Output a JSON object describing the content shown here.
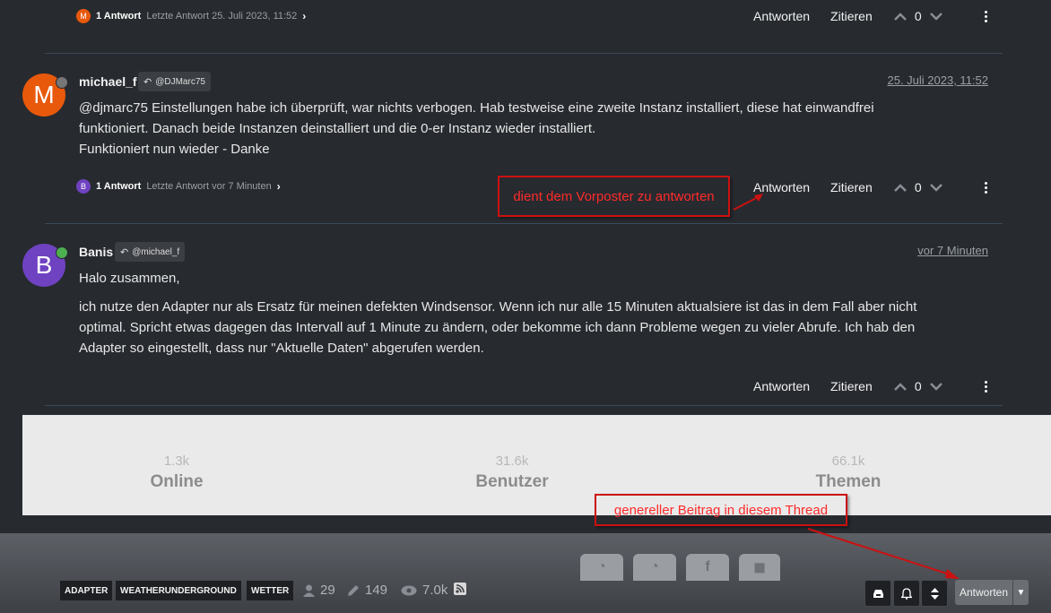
{
  "post_top": {
    "reply_avatar_letter": "M",
    "reply_count": "1 Antwort",
    "last_reply": "Letzte Antwort 25. Juli 2023, 11:52"
  },
  "post_michael": {
    "avatar_letter": "M",
    "author": "michael_f",
    "reply_to": "@DJMarc75",
    "timestamp": "25. Juli 2023, 11:52",
    "line1": "@djmarc75 Einstellungen habe ich überprüft, war nichts verbogen. Hab testweise eine zweite Instanz installiert, diese hat einwandfrei",
    "line2": "funktioniert. Danach beide Instanzen deinstalliert und die 0-er Instanz wieder installiert.",
    "line3": "Funktioniert nun wieder - Danke",
    "reply_avatar_letter": "B",
    "reply_count": "1 Antwort",
    "last_reply": "Letzte Antwort vor 7 Minuten"
  },
  "post_banis": {
    "avatar_letter": "B",
    "author": "Banis",
    "reply_to": "@michael_f",
    "timestamp": "vor 7 Minuten",
    "greeting": "Halo zusammen,",
    "para_line1": "ich nutze den Adapter nur als Ersatz für meinen defekten Windsensor. Wenn ich nur alle 15 Minuten aktualsiere ist das in dem Fall aber nicht",
    "para_line2": "optimal. Spricht etwas dagegen das Intervall auf 1 Minute zu ändern, oder bekomme ich dann Probleme wegen zu vieler Abrufe. Ich hab den",
    "para_line3": "Adapter so eingestellt, dass nur \"Aktuelle Daten\" abgerufen werden."
  },
  "actions": {
    "reply": "Antworten",
    "quote": "Zitieren",
    "votes": "0"
  },
  "annotations": {
    "reply_to_previous": "dient dem Vorposter zu antworten",
    "general_post": "genereller Beitrag in diesem Thread"
  },
  "stats": [
    {
      "value": "1.3k",
      "label": "Online"
    },
    {
      "value": "31.6k",
      "label": "Benutzer"
    },
    {
      "value": "66.1k",
      "label": "Themen"
    }
  ],
  "tags": [
    "ADAPTER",
    "WEATHERUNDERGROUND",
    "WETTER"
  ],
  "thread_stats": {
    "posters": "29",
    "posts": "149",
    "views": "7.0k"
  },
  "bottom_reply": "Antworten",
  "colors": {
    "avatar_m": "#e8590c",
    "avatar_b": "#6f42c1",
    "online": "#4caf50",
    "offline": "#777777",
    "annotation": "#cc1111"
  },
  "icons": [
    "chevron-right-icon",
    "reply-icon",
    "chevron-up-icon",
    "chevron-down-icon",
    "kebab-icon",
    "user-icon",
    "pencil-icon",
    "eye-icon",
    "rss-icon",
    "inbox-icon",
    "bell-icon",
    "sort-icon",
    "caret-down-icon"
  ]
}
